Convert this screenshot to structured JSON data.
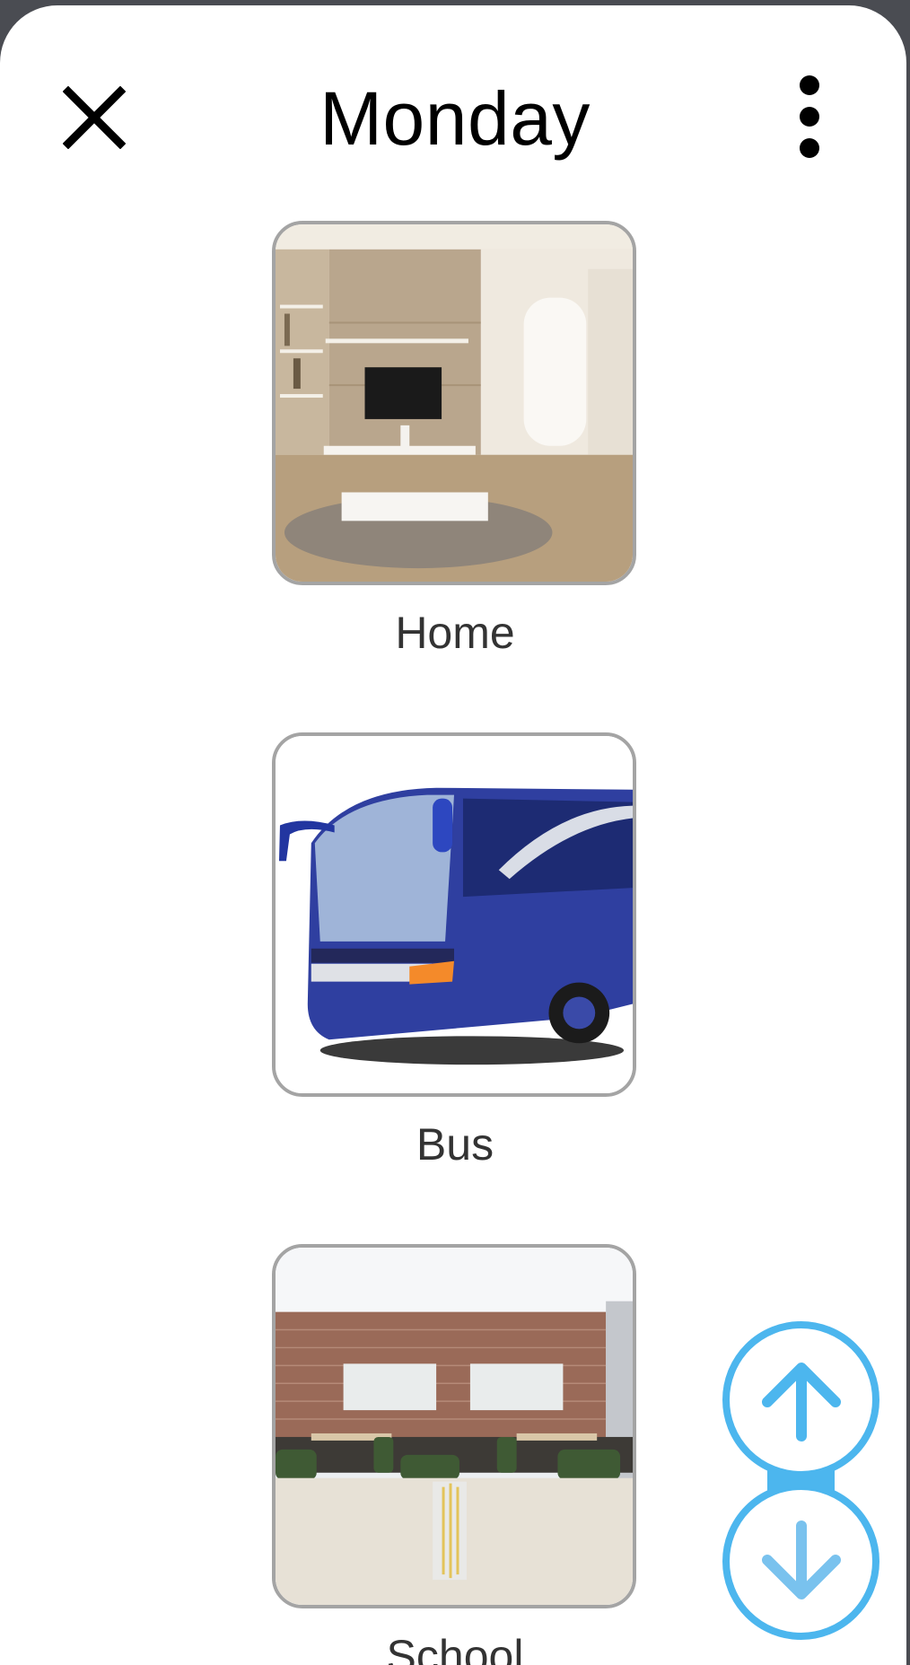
{
  "header": {
    "title": "Monday"
  },
  "items": [
    {
      "label": "Home"
    },
    {
      "label": "Bus"
    },
    {
      "label": "School"
    }
  ],
  "colors": {
    "accent": "#4cb6ee",
    "tile_border": "#a4a4a4"
  }
}
